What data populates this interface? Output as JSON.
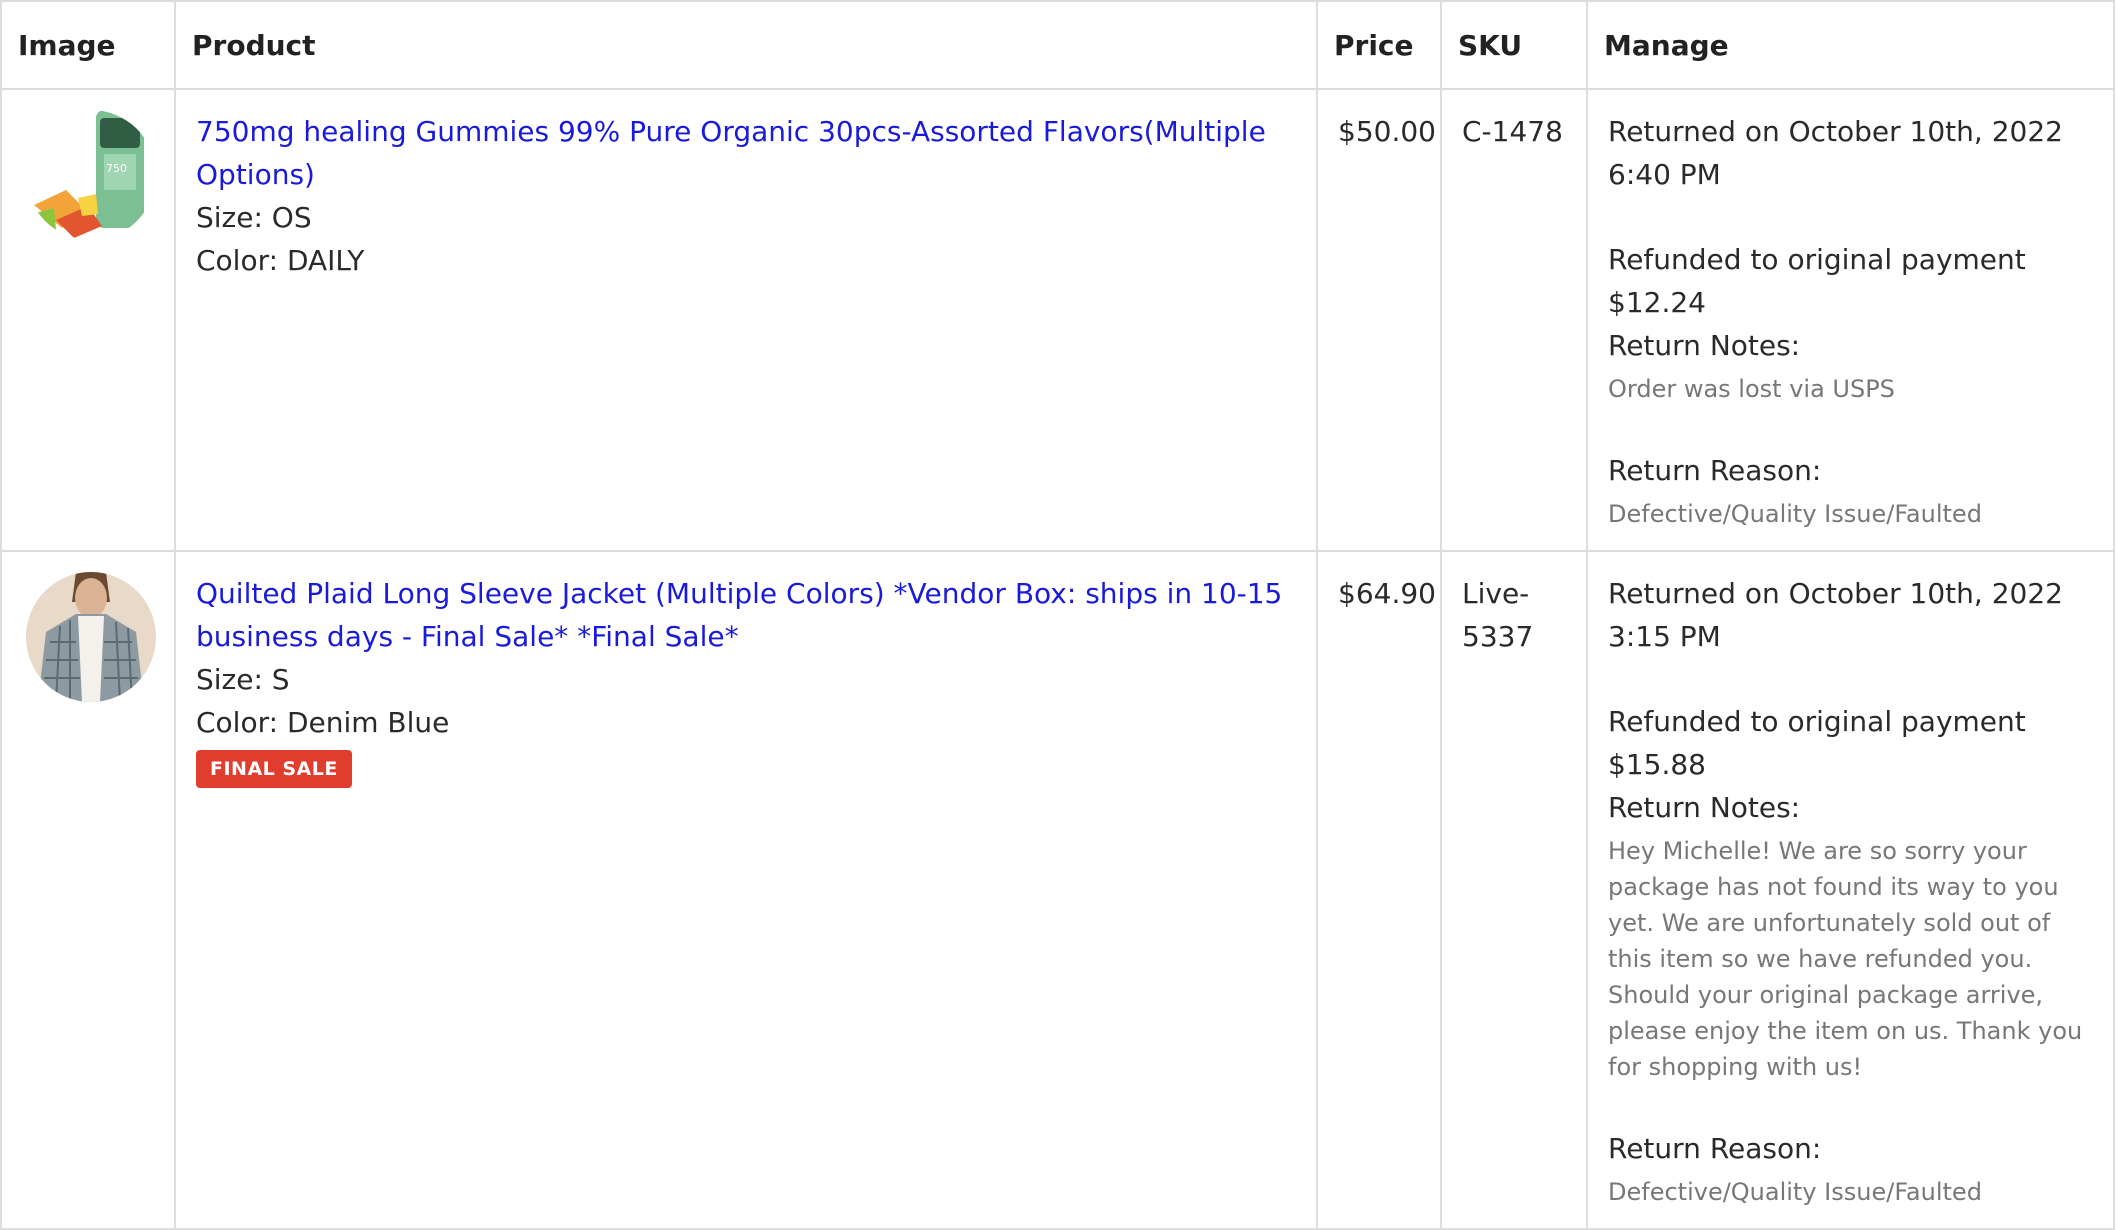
{
  "headers": {
    "image": "Image",
    "product": "Product",
    "price": "Price",
    "sku": "SKU",
    "manage": "Manage"
  },
  "rows": [
    {
      "product_name": "750mg healing Gummies 99% Pure Organic 30pcs-Assorted Flavors(Multiple Options)",
      "size": "Size: OS",
      "color": "Color: DAILY",
      "badge": "",
      "price": "$50.00",
      "sku": "C-1478",
      "returned": "Returned on October 10th, 2022 6:40 PM",
      "refund": "Refunded to original payment $12.24",
      "notes_label": "Return Notes:",
      "notes": "Order was lost via USPS",
      "reason_label": "Return Reason:",
      "reason": "Defective/Quality Issue/Faulted"
    },
    {
      "product_name": "Quilted Plaid Long Sleeve Jacket (Multiple Colors) *Vendor Box: ships in 10-15 business days - Final Sale* *Final Sale*",
      "size": "Size: S",
      "color": "Color: Denim Blue",
      "badge": "FINAL SALE",
      "price": "$64.90",
      "sku": "Live-5337",
      "returned": "Returned on October 10th, 2022 3:15 PM",
      "refund": "Refunded to original payment $15.88",
      "notes_label": "Return Notes:",
      "notes": "Hey Michelle! We are so sorry your package has not found its way to you yet. We are unfortunately sold out of this item so we have refunded you. Should your original package arrive, please enjoy the item on us. Thank you for shopping with us!",
      "reason_label": "Return Reason:",
      "reason": "Defective/Quality Issue/Faulted"
    }
  ],
  "colors": {
    "link": "#1a1adb",
    "badge": "#e03d2f",
    "border": "#dddddd",
    "muted": "#777777"
  }
}
